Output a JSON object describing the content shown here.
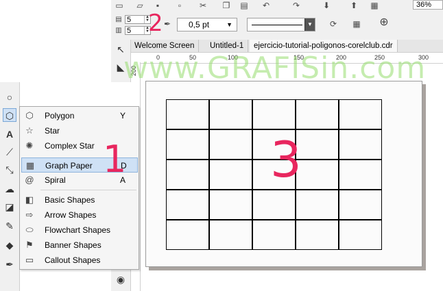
{
  "toolbar": {
    "zoom_value": "36%",
    "rows_value": "5",
    "cols_value": "5",
    "outline_width": "0,5 pt",
    "icons": [
      "new-icon",
      "open-icon",
      "save-icon",
      "print-icon",
      "cut-icon",
      "copy-icon",
      "paste-icon",
      "undo-icon",
      "redo-icon",
      "import-icon",
      "export-icon",
      "publish-icon"
    ]
  },
  "tabs": [
    "Welcome Screen",
    "Untitled-1",
    "ejercicio-tutorial-poligonos-corelclub.cdr"
  ],
  "ruler": {
    "h_labels": [
      "0",
      "50",
      "100",
      "150",
      "200",
      "250",
      "300"
    ],
    "v_label": "200"
  },
  "flyout": {
    "items": [
      {
        "label": "Polygon",
        "shortcut": "Y",
        "icon": "polygon-icon"
      },
      {
        "label": "Star",
        "shortcut": "",
        "icon": "star-icon"
      },
      {
        "label": "Complex Star",
        "shortcut": "",
        "icon": "complex-star-icon"
      },
      {
        "label": "Graph Paper",
        "shortcut": "D",
        "icon": "graph-paper-icon",
        "selected": true
      },
      {
        "label": "Spiral",
        "shortcut": "A",
        "icon": "spiral-icon"
      },
      {
        "label": "Basic Shapes",
        "shortcut": "",
        "icon": "basic-shapes-icon"
      },
      {
        "label": "Arrow Shapes",
        "shortcut": "",
        "icon": "arrow-shapes-icon"
      },
      {
        "label": "Flowchart Shapes",
        "shortcut": "",
        "icon": "flowchart-shapes-icon"
      },
      {
        "label": "Banner Shapes",
        "shortcut": "",
        "icon": "banner-shapes-icon"
      },
      {
        "label": "Callout Shapes",
        "shortcut": "",
        "icon": "callout-shapes-icon"
      }
    ]
  },
  "grid": {
    "rows": 5,
    "cols": 5
  },
  "annotations": {
    "one": "1",
    "two": "2",
    "three": "3",
    "accent": "#e8265e"
  },
  "watermark": "www.GRAFISin.com"
}
